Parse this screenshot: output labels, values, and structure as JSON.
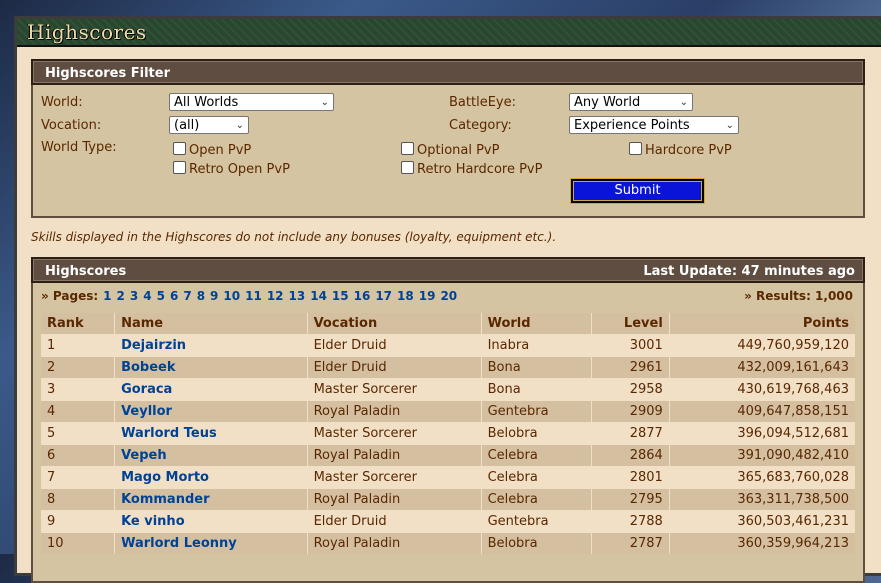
{
  "title": "Highscores",
  "filter": {
    "header": "Highscores Filter",
    "world_label": "World:",
    "world_value": "All Worlds",
    "vocation_label": "Vocation:",
    "vocation_value": "(all)",
    "world_type_label": "World Type:",
    "battleye_label": "BattleEye:",
    "battleye_value": "Any World",
    "category_label": "Category:",
    "category_value": "Experience Points",
    "checkboxes": [
      "Open PvP",
      "Optional PvP",
      "Hardcore PvP",
      "Retro Open PvP",
      "Retro Hardcore PvP"
    ],
    "submit": "Submit"
  },
  "note": "Skills displayed in the Highscores do not include any bonuses (loyalty, equipment etc.).",
  "highscores": {
    "header": "Highscores",
    "last_update": "Last Update: 47 minutes ago",
    "pages_label": "» Pages:",
    "pages": [
      "1",
      "2",
      "3",
      "4",
      "5",
      "6",
      "7",
      "8",
      "9",
      "10",
      "11",
      "12",
      "13",
      "14",
      "15",
      "16",
      "17",
      "18",
      "19",
      "20"
    ],
    "results": "» Results: 1,000",
    "columns": [
      "Rank",
      "Name",
      "Vocation",
      "World",
      "Level",
      "Points"
    ],
    "rows": [
      [
        "1",
        "Dejairzin",
        "Elder Druid",
        "Inabra",
        "3001",
        "449,760,959,120"
      ],
      [
        "2",
        "Bobeek",
        "Elder Druid",
        "Bona",
        "2961",
        "432,009,161,643"
      ],
      [
        "3",
        "Goraca",
        "Master Sorcerer",
        "Bona",
        "2958",
        "430,619,768,463"
      ],
      [
        "4",
        "Veyllor",
        "Royal Paladin",
        "Gentebra",
        "2909",
        "409,647,858,151"
      ],
      [
        "5",
        "Warlord Teus",
        "Master Sorcerer",
        "Belobra",
        "2877",
        "396,094,512,681"
      ],
      [
        "6",
        "Vepeh",
        "Royal Paladin",
        "Celebra",
        "2864",
        "391,090,482,410"
      ],
      [
        "7",
        "Mago Morto",
        "Master Sorcerer",
        "Celebra",
        "2801",
        "365,683,760,028"
      ],
      [
        "8",
        "Kommander",
        "Royal Paladin",
        "Celebra",
        "2795",
        "363,311,738,500"
      ],
      [
        "9",
        "Ke vinho",
        "Elder Druid",
        "Gentebra",
        "2788",
        "360,503,461,231"
      ],
      [
        "10",
        "Warlord Leonny",
        "Royal Paladin",
        "Belobra",
        "2787",
        "360,359,964,213"
      ]
    ]
  }
}
